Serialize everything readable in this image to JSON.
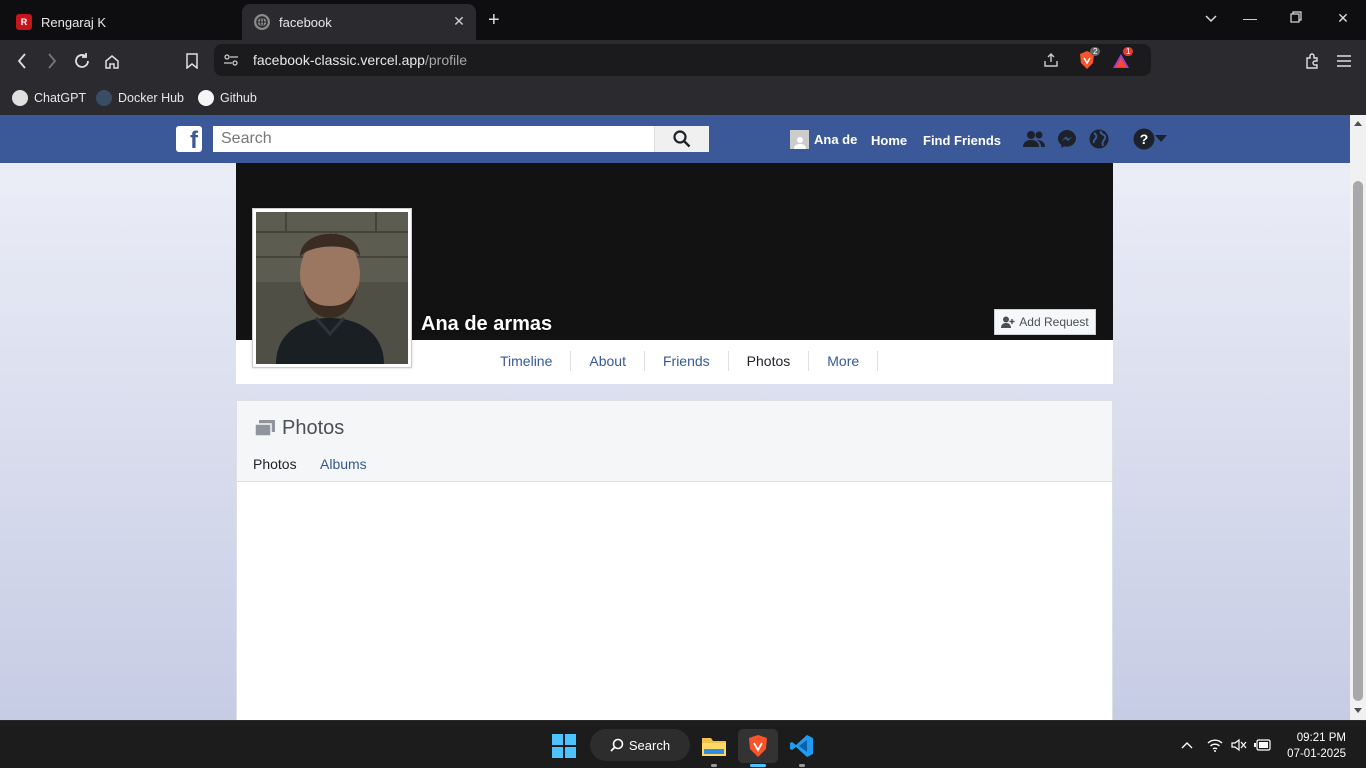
{
  "browser": {
    "tabs": [
      {
        "title": "Rengaraj K",
        "active": false
      },
      {
        "title": "facebook",
        "active": true
      }
    ],
    "url": {
      "host": "facebook-classic.vercel.app",
      "path": "/profile"
    },
    "bookmarks": [
      {
        "label": "ChatGPT",
        "icon": "chatgpt-icon"
      },
      {
        "label": "Docker Hub",
        "icon": "docker-icon"
      },
      {
        "label": "Github",
        "icon": "github-icon"
      }
    ],
    "brave_shield_count": "2",
    "rewards_count": "1"
  },
  "fb": {
    "logo": "f",
    "search_placeholder": "Search",
    "user_name": "Ana de",
    "home": "Home",
    "find_friends": "Find Friends"
  },
  "profile": {
    "name": "Ana de armas",
    "add_request": "Add Request",
    "tabs": [
      "Timeline",
      "About",
      "Friends",
      "Photos",
      "More"
    ],
    "selected_tab": "Photos"
  },
  "photos": {
    "title": "Photos",
    "subtabs": [
      "Photos",
      "Albums"
    ]
  },
  "taskbar": {
    "search_label": "Search",
    "time": "09:21 PM",
    "date": "07-01-2025"
  },
  "colors": {
    "fb_blue": "#3b5998",
    "link_blue": "#365899"
  }
}
